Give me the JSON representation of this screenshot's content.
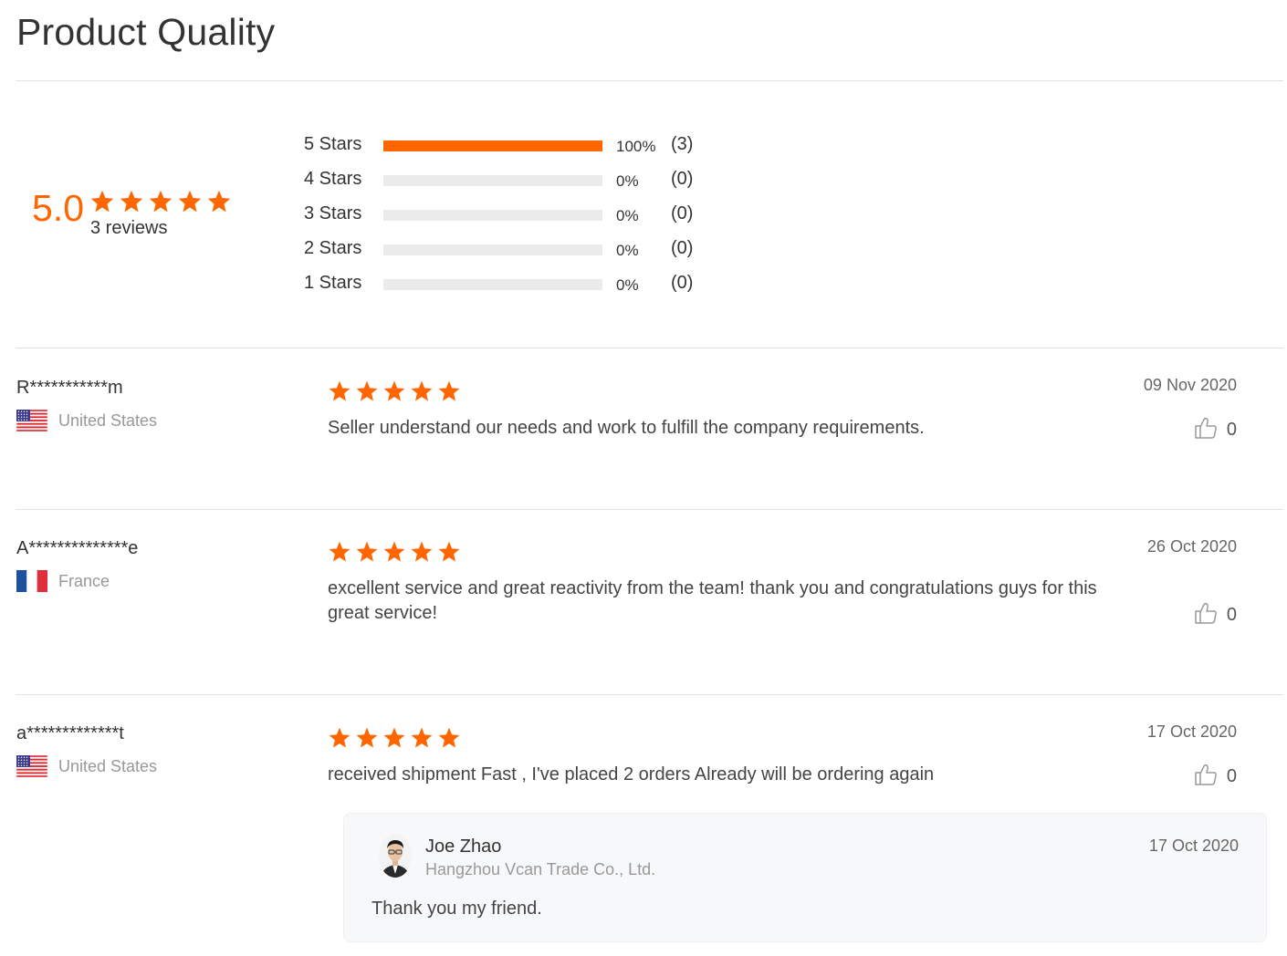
{
  "page": {
    "title": "Product Quality"
  },
  "colors": {
    "accent": "#ff6600",
    "divider": "#e2e2e2",
    "muted_text": "#999999"
  },
  "summary": {
    "score": "5.0",
    "stars": 5,
    "review_count_label": "3 reviews",
    "distribution": [
      {
        "label": "5  Stars",
        "percent": 100,
        "percent_label": "100%",
        "count_label": "(3)"
      },
      {
        "label": "4  Stars",
        "percent": 0,
        "percent_label": "0%",
        "count_label": "(0)"
      },
      {
        "label": "3  Stars",
        "percent": 0,
        "percent_label": "0%",
        "count_label": "(0)"
      },
      {
        "label": "2  Stars",
        "percent": 0,
        "percent_label": "0%",
        "count_label": "(0)"
      },
      {
        "label": "1  Stars",
        "percent": 0,
        "percent_label": "0%",
        "count_label": "(0)"
      }
    ]
  },
  "reviews": [
    {
      "reviewer": "R***********m",
      "country": "United States",
      "flag_icon": "us-flag-icon",
      "rating": 5,
      "text": "Seller understand our needs and work to fulfill the company requirements.",
      "date": "09 Nov 2020",
      "likes": "0"
    },
    {
      "reviewer": "A**************e",
      "country": "France",
      "flag_icon": "france-flag-icon",
      "rating": 5,
      "text": "excellent service and great reactivity from the team! thank you and congratulations guys for this great service!",
      "date": "26 Oct 2020",
      "likes": "0"
    },
    {
      "reviewer": "a*************t",
      "country": "United States",
      "flag_icon": "us-flag-icon",
      "rating": 5,
      "text": "received shipment Fast , I've placed 2 orders Already will be ordering again",
      "date": "17 Oct 2020",
      "likes": "0",
      "reply": {
        "name": "Joe Zhao",
        "company": "Hangzhou Vcan Trade Co., Ltd.",
        "date": "17 Oct 2020",
        "text": "Thank you my friend."
      }
    }
  ]
}
